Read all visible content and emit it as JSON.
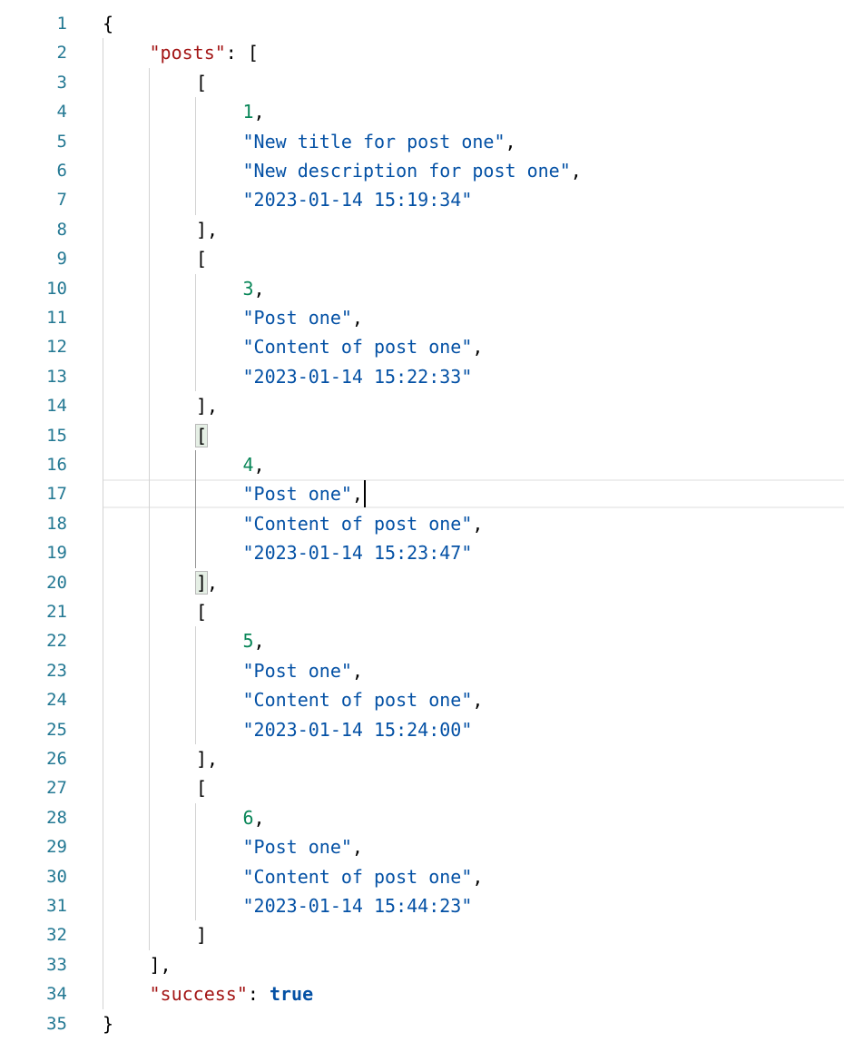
{
  "editor": {
    "language": "json",
    "cursor": {
      "line": 17,
      "column_after": "\"Post one\","
    },
    "current_line": 17,
    "matched_brackets": [
      15,
      20
    ],
    "lines": [
      {
        "n": "1",
        "indent": 0,
        "tokens": [
          {
            "t": "{",
            "k": "punct"
          }
        ]
      },
      {
        "n": "2",
        "indent": 1,
        "tokens": [
          {
            "t": "\"posts\"",
            "k": "key"
          },
          {
            "t": ": [",
            "k": "punct"
          }
        ]
      },
      {
        "n": "3",
        "indent": 2,
        "tokens": [
          {
            "t": "[",
            "k": "punct"
          }
        ]
      },
      {
        "n": "4",
        "indent": 3,
        "tokens": [
          {
            "t": "1",
            "k": "num"
          },
          {
            "t": ",",
            "k": "punct"
          }
        ]
      },
      {
        "n": "5",
        "indent": 3,
        "tokens": [
          {
            "t": "\"New title for post one\"",
            "k": "str"
          },
          {
            "t": ",",
            "k": "punct"
          }
        ]
      },
      {
        "n": "6",
        "indent": 3,
        "tokens": [
          {
            "t": "\"New description for post one\"",
            "k": "str"
          },
          {
            "t": ",",
            "k": "punct"
          }
        ]
      },
      {
        "n": "7",
        "indent": 3,
        "tokens": [
          {
            "t": "\"2023-01-14 15:19:34\"",
            "k": "str"
          }
        ]
      },
      {
        "n": "8",
        "indent": 2,
        "tokens": [
          {
            "t": "],",
            "k": "punct"
          }
        ]
      },
      {
        "n": "9",
        "indent": 2,
        "tokens": [
          {
            "t": "[",
            "k": "punct"
          }
        ]
      },
      {
        "n": "10",
        "indent": 3,
        "tokens": [
          {
            "t": "3",
            "k": "num"
          },
          {
            "t": ",",
            "k": "punct"
          }
        ]
      },
      {
        "n": "11",
        "indent": 3,
        "tokens": [
          {
            "t": "\"Post one\"",
            "k": "str"
          },
          {
            "t": ",",
            "k": "punct"
          }
        ]
      },
      {
        "n": "12",
        "indent": 3,
        "tokens": [
          {
            "t": "\"Content of post one\"",
            "k": "str"
          },
          {
            "t": ",",
            "k": "punct"
          }
        ]
      },
      {
        "n": "13",
        "indent": 3,
        "tokens": [
          {
            "t": "\"2023-01-14 15:22:33\"",
            "k": "str"
          }
        ]
      },
      {
        "n": "14",
        "indent": 2,
        "tokens": [
          {
            "t": "],",
            "k": "punct"
          }
        ]
      },
      {
        "n": "15",
        "indent": 2,
        "tokens": [
          {
            "t": "[",
            "k": "punct",
            "match": true
          }
        ]
      },
      {
        "n": "16",
        "indent": 3,
        "tokens": [
          {
            "t": "4",
            "k": "num"
          },
          {
            "t": ",",
            "k": "punct"
          }
        ]
      },
      {
        "n": "17",
        "indent": 3,
        "tokens": [
          {
            "t": "\"Post one\"",
            "k": "str"
          },
          {
            "t": ",",
            "k": "punct"
          }
        ]
      },
      {
        "n": "18",
        "indent": 3,
        "tokens": [
          {
            "t": "\"Content of post one\"",
            "k": "str"
          },
          {
            "t": ",",
            "k": "punct"
          }
        ]
      },
      {
        "n": "19",
        "indent": 3,
        "tokens": [
          {
            "t": "\"2023-01-14 15:23:47\"",
            "k": "str"
          }
        ]
      },
      {
        "n": "20",
        "indent": 2,
        "tokens": [
          {
            "t": "]",
            "k": "punct",
            "match": true
          },
          {
            "t": ",",
            "k": "punct"
          }
        ]
      },
      {
        "n": "21",
        "indent": 2,
        "tokens": [
          {
            "t": "[",
            "k": "punct"
          }
        ]
      },
      {
        "n": "22",
        "indent": 3,
        "tokens": [
          {
            "t": "5",
            "k": "num"
          },
          {
            "t": ",",
            "k": "punct"
          }
        ]
      },
      {
        "n": "23",
        "indent": 3,
        "tokens": [
          {
            "t": "\"Post one\"",
            "k": "str"
          },
          {
            "t": ",",
            "k": "punct"
          }
        ]
      },
      {
        "n": "24",
        "indent": 3,
        "tokens": [
          {
            "t": "\"Content of post one\"",
            "k": "str"
          },
          {
            "t": ",",
            "k": "punct"
          }
        ]
      },
      {
        "n": "25",
        "indent": 3,
        "tokens": [
          {
            "t": "\"2023-01-14 15:24:00\"",
            "k": "str"
          }
        ]
      },
      {
        "n": "26",
        "indent": 2,
        "tokens": [
          {
            "t": "],",
            "k": "punct"
          }
        ]
      },
      {
        "n": "27",
        "indent": 2,
        "tokens": [
          {
            "t": "[",
            "k": "punct"
          }
        ]
      },
      {
        "n": "28",
        "indent": 3,
        "tokens": [
          {
            "t": "6",
            "k": "num"
          },
          {
            "t": ",",
            "k": "punct"
          }
        ]
      },
      {
        "n": "29",
        "indent": 3,
        "tokens": [
          {
            "t": "\"Post one\"",
            "k": "str"
          },
          {
            "t": ",",
            "k": "punct"
          }
        ]
      },
      {
        "n": "30",
        "indent": 3,
        "tokens": [
          {
            "t": "\"Content of post one\"",
            "k": "str"
          },
          {
            "t": ",",
            "k": "punct"
          }
        ]
      },
      {
        "n": "31",
        "indent": 3,
        "tokens": [
          {
            "t": "\"2023-01-14 15:44:23\"",
            "k": "str"
          }
        ]
      },
      {
        "n": "32",
        "indent": 2,
        "tokens": [
          {
            "t": "]",
            "k": "punct"
          }
        ]
      },
      {
        "n": "33",
        "indent": 1,
        "tokens": [
          {
            "t": "],",
            "k": "punct"
          }
        ]
      },
      {
        "n": "34",
        "indent": 1,
        "tokens": [
          {
            "t": "\"success\"",
            "k": "key"
          },
          {
            "t": ": ",
            "k": "punct"
          },
          {
            "t": "true",
            "k": "bool"
          }
        ]
      },
      {
        "n": "35",
        "indent": 0,
        "tokens": [
          {
            "t": "}",
            "k": "punct"
          }
        ]
      }
    ],
    "colors": {
      "line_number": "#237893",
      "key": "#a31515",
      "string": "#0451a5",
      "number": "#098658",
      "boolean": "#0451a5",
      "punctuation": "#000000"
    }
  }
}
